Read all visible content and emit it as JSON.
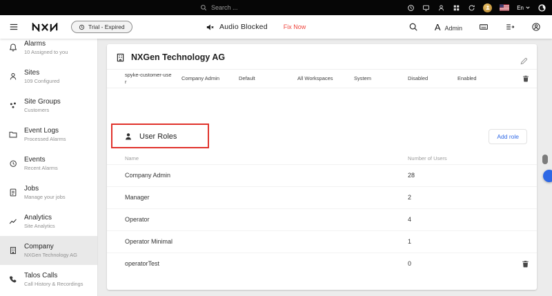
{
  "colors": {
    "accent": "#2e68e5",
    "alert": "#ef423a",
    "annotation": "#e0312a",
    "topbar_bg": "#060606"
  },
  "topbar": {
    "search_placeholder": "Search ...",
    "language": "En"
  },
  "appbar": {
    "trial_badge": "Trial - Expired",
    "audio_blocked": "Audio Blocked",
    "fix_now": "Fix Now",
    "font_button": "A",
    "admin_label": "Admin"
  },
  "sidebar": {
    "items": [
      {
        "icon": "bell",
        "label": "Alarms",
        "sub": "10 Assigned to you"
      },
      {
        "icon": "person",
        "label": "Sites",
        "sub": "109 Configured"
      },
      {
        "icon": "dots-cluster",
        "label": "Site Groups",
        "sub": "Customers"
      },
      {
        "icon": "folder",
        "label": "Event Logs",
        "sub": "Processed Alarms"
      },
      {
        "icon": "history-clock",
        "label": "Events",
        "sub": "Recent Alarms"
      },
      {
        "icon": "checklist",
        "label": "Jobs",
        "sub": "Manage your jobs"
      },
      {
        "icon": "line-chart",
        "label": "Analytics",
        "sub": "Site Analytics"
      },
      {
        "icon": "building",
        "label": "Company",
        "sub": "NXGen Technology AG",
        "selected": true
      },
      {
        "icon": "phone",
        "label": "Talos Calls",
        "sub": "Call History & Recordings"
      }
    ]
  },
  "main": {
    "company_title": "NXGen Technology AG",
    "mini_row": {
      "name": "spyke-customer-user",
      "cells": [
        "Company Admin",
        "Default",
        "All Workspaces",
        "System",
        "Disabled",
        "Enabled"
      ]
    },
    "user_roles": {
      "title": "User Roles",
      "add_button": "Add role",
      "columns": [
        "Name",
        "Number of Users"
      ],
      "rows": [
        {
          "name": "Company Admin",
          "count": "28"
        },
        {
          "name": "Manager",
          "count": "2"
        },
        {
          "name": "Operator",
          "count": "4"
        },
        {
          "name": "Operator Minimal",
          "count": "1"
        },
        {
          "name": "operatorTest",
          "count": "0"
        }
      ]
    }
  }
}
